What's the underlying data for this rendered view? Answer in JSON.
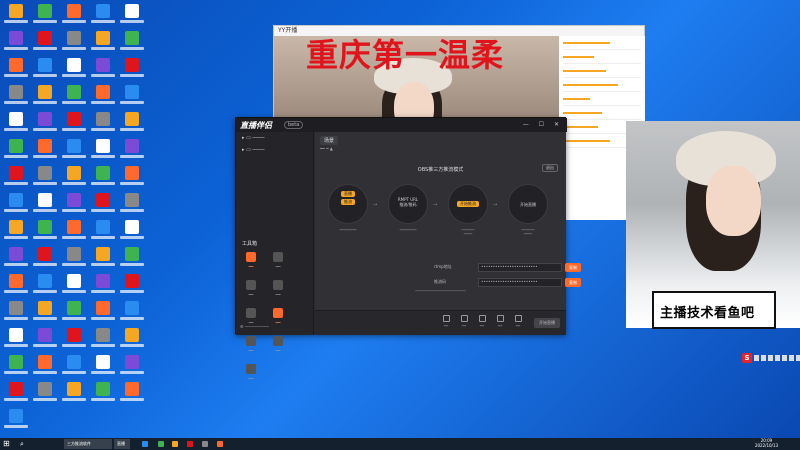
{
  "desktop": {
    "icon_count": 76
  },
  "yy_window": {
    "app_label": "YY开播",
    "stream_title": "重庆第一温柔"
  },
  "live_window": {
    "logo": "直播伴侣",
    "version": "beta",
    "tab": "场景",
    "heading": "OBS推三方推流模式",
    "exit_label": "退出",
    "step1_pill_a": "直播",
    "step1_pill_b": "推流",
    "step2_label": "推流/推码",
    "step2_sub": "RMPT URL",
    "step3_pill": "开始推流",
    "step4_label": "开始直播",
    "rtmp_label": "rtmp地址",
    "key_label": "推流码",
    "copy_label": "复制",
    "tools_title": "工具箱",
    "toolbar_start": "开始直播"
  },
  "webcam": {
    "caption": "主播技术看鱼吧"
  },
  "watermark": {
    "letter": "S"
  },
  "taskbar": {
    "start_icon": "windows-logo-icon",
    "search_icon": "search-icon",
    "tasks": [
      "三方推流软件",
      "直播"
    ],
    "time": "20:09",
    "date": "2022/10/13"
  },
  "colors": {
    "desktop_blue": "#0c63d6",
    "accent_orange": "#ff6a2c",
    "title_red": "#e0141c"
  }
}
